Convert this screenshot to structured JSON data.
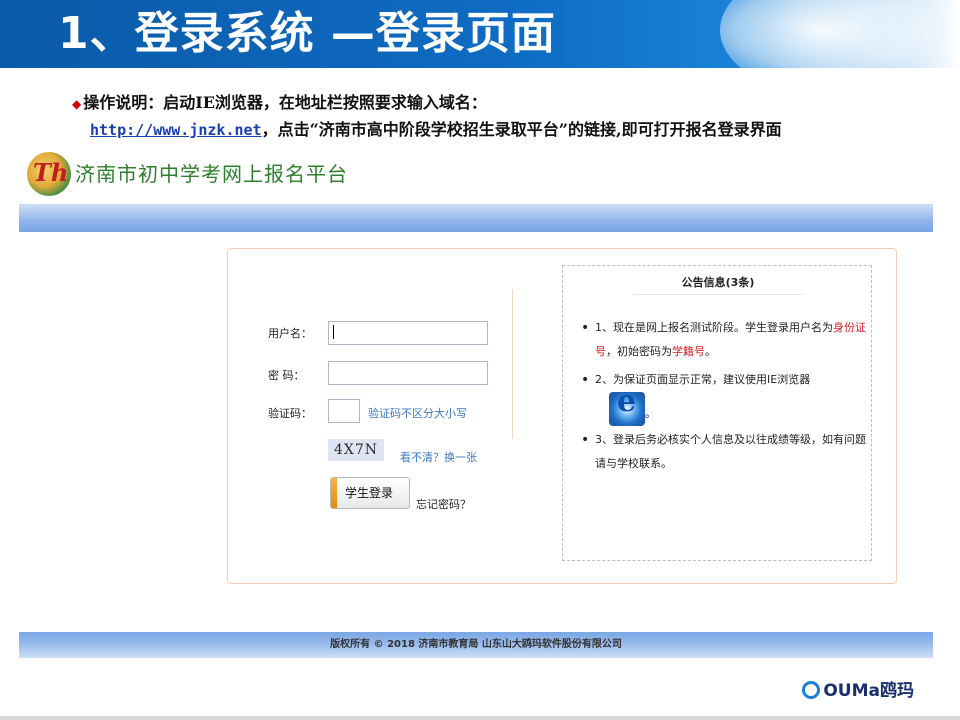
{
  "slide": {
    "title": "1、登录系统 —登录页面",
    "instruction_prefix": "操作说明：启动IE浏览器，在地址栏按照要求输入域名：",
    "url": "http://www.jnzk.net",
    "instruction_suffix": "，点击“济南市高中阶段学校招生录取平台”的链接,即可打开报名登录界面"
  },
  "site": {
    "logo_text": "Th",
    "title": "济南市初中学考网上报名平台",
    "copyright": "版权所有 © 2018 济南市教育局 山东山大鸥玛软件股份有限公司"
  },
  "login": {
    "username_label": "用户名：",
    "password_label": "密 码：",
    "captcha_label": "验证码：",
    "captcha_hint": "验证码不区分大小写",
    "captcha_value": "4X7N",
    "refresh_link": "看不清？换一张",
    "login_button": "学生登录",
    "forgot_link": "忘记密码？"
  },
  "notice": {
    "title": "公告信息(3条)",
    "items": [
      {
        "text": "1、现在是网上报名测试阶段。学生登录用户名为",
        "red1": "身份证号",
        "mid": "，初始密码为",
        "red2": "学籍号",
        "end": "。"
      },
      {
        "text": "2、为保证页面显示正常，建议使用IE浏览器",
        "end": "。"
      },
      {
        "text": "3、登录后务必核实个人信息及以往成绩等级，如有问题请与学校联系。"
      }
    ]
  },
  "brand": {
    "name": "OUMa鸥玛"
  },
  "colors": {
    "header_blue": "#0b5aa8",
    "site_green": "#2d7f2d",
    "notice_red": "#d81e1e",
    "hint_blue": "#3a79c4"
  }
}
